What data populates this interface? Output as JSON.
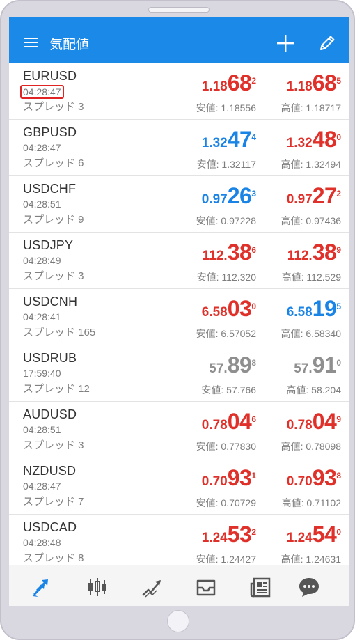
{
  "header": {
    "title": "気配値",
    "menu_icon": "menu-icon",
    "add_icon": "plus-icon",
    "edit_icon": "pencil-icon"
  },
  "colors": {
    "appbar": "#1a89e8",
    "down": "#e0302a",
    "up": "#1a84e6",
    "neutral": "#8f8f8f",
    "nav_active": "#1a84e6",
    "nav_inactive": "#555555"
  },
  "quotes": [
    {
      "symbol": "EURUSD",
      "time": "04:28:47",
      "spread": "スプレッド 3",
      "bid": {
        "small": "1.18",
        "big": "68",
        "sup": "2",
        "color": "red"
      },
      "ask": {
        "small": "1.18",
        "big": "68",
        "sup": "5",
        "color": "red"
      },
      "low": "安値: 1.18556",
      "high": "高値: 1.18717"
    },
    {
      "symbol": "GBPUSD",
      "time": "04:28:47",
      "spread": "スプレッド 6",
      "bid": {
        "small": "1.32",
        "big": "47",
        "sup": "4",
        "color": "blue"
      },
      "ask": {
        "small": "1.32",
        "big": "48",
        "sup": "0",
        "color": "red"
      },
      "low": "安値: 1.32117",
      "high": "高値: 1.32494"
    },
    {
      "symbol": "USDCHF",
      "time": "04:28:51",
      "spread": "スプレッド 9",
      "bid": {
        "small": "0.97",
        "big": "26",
        "sup": "3",
        "color": "blue"
      },
      "ask": {
        "small": "0.97",
        "big": "27",
        "sup": "2",
        "color": "red"
      },
      "low": "安値: 0.97228",
      "high": "高値: 0.97436"
    },
    {
      "symbol": "USDJPY",
      "time": "04:28:49",
      "spread": "スプレッド 3",
      "bid": {
        "small": "112.",
        "big": "38",
        "sup": "6",
        "color": "red"
      },
      "ask": {
        "small": "112.",
        "big": "38",
        "sup": "9",
        "color": "red"
      },
      "low": "安値: 112.320",
      "high": "高値: 112.529"
    },
    {
      "symbol": "USDCNH",
      "time": "04:28:41",
      "spread": "スプレッド 165",
      "bid": {
        "small": "6.58",
        "big": "03",
        "sup": "0",
        "color": "red"
      },
      "ask": {
        "small": "6.58",
        "big": "19",
        "sup": "5",
        "color": "blue"
      },
      "low": "安値: 6.57052",
      "high": "高値: 6.58340"
    },
    {
      "symbol": "USDRUB",
      "time": "17:59:40",
      "spread": "スプレッド 12",
      "bid": {
        "small": "57.",
        "big": "89",
        "sup": "8",
        "color": "grey"
      },
      "ask": {
        "small": "57.",
        "big": "91",
        "sup": "0",
        "color": "grey"
      },
      "low": "安値: 57.766",
      "high": "高値: 58.204"
    },
    {
      "symbol": "AUDUSD",
      "time": "04:28:51",
      "spread": "スプレッド 3",
      "bid": {
        "small": "0.78",
        "big": "04",
        "sup": "6",
        "color": "red"
      },
      "ask": {
        "small": "0.78",
        "big": "04",
        "sup": "9",
        "color": "red"
      },
      "low": "安値: 0.77830",
      "high": "高値: 0.78098"
    },
    {
      "symbol": "NZDUSD",
      "time": "04:28:47",
      "spread": "スプレッド 7",
      "bid": {
        "small": "0.70",
        "big": "93",
        "sup": "1",
        "color": "red"
      },
      "ask": {
        "small": "0.70",
        "big": "93",
        "sup": "8",
        "color": "red"
      },
      "low": "安値: 0.70729",
      "high": "高値: 0.71102"
    },
    {
      "symbol": "USDCAD",
      "time": "04:28:48",
      "spread": "スプレッド 8",
      "bid": {
        "small": "1.24",
        "big": "53",
        "sup": "2",
        "color": "red"
      },
      "ask": {
        "small": "1.24",
        "big": "54",
        "sup": "0",
        "color": "red"
      },
      "low": "安値: 1.24427",
      "high": "高値: 1.24631"
    }
  ],
  "nav": [
    {
      "icon": "quotes-arrows-icon",
      "active": true
    },
    {
      "icon": "candlestick-chart-icon",
      "active": false
    },
    {
      "icon": "trade-trend-icon",
      "active": false
    },
    {
      "icon": "inbox-icon",
      "active": false
    },
    {
      "icon": "news-icon",
      "active": false
    },
    {
      "icon": "chat-bubble-icon",
      "active": false
    }
  ]
}
